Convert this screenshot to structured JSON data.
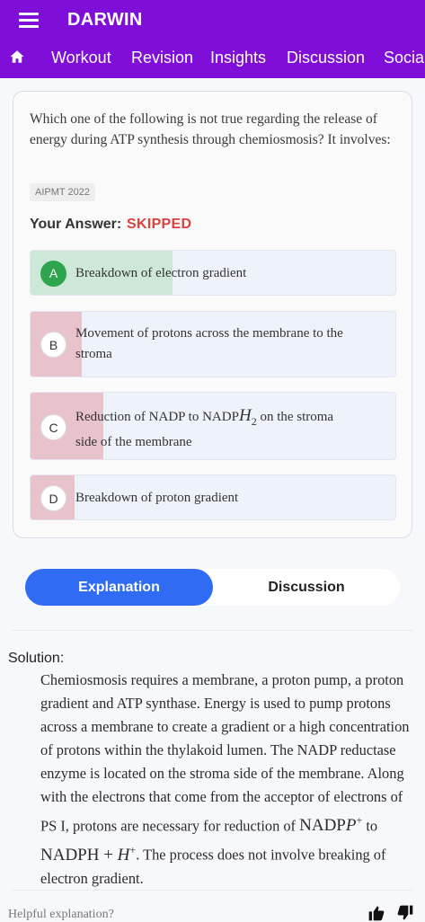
{
  "header": {
    "app_title": "DARWIN",
    "tabs": [
      "Workout",
      "Revision",
      "Insights",
      "Discussion",
      "Social"
    ]
  },
  "question": {
    "text": "Which one of the following is not true regarding the release of energy during ATP synthesis through chemiosmosis? It involves:",
    "exam_tag": "AIPMT 2022",
    "answer_label": "Your Answer:",
    "answer_value": "SKIPPED",
    "options": [
      {
        "letter": "A",
        "text": "Breakdown of electron gradient",
        "correct": true,
        "fill_fraction": 0.39
      },
      {
        "letter": "B",
        "text": "Movement of protons across the membrane to the stroma",
        "correct": false,
        "fill_fraction": 0.14
      },
      {
        "letter": "C",
        "text_before": "Reduction of NADP to NADP",
        "text_math": "H",
        "text_sub": "2",
        "text_after": " on the stroma side of the membrane",
        "correct": false,
        "fill_fraction": 0.2
      },
      {
        "letter": "D",
        "text": "Breakdown of proton gradient",
        "correct": false,
        "fill_fraction": 0.12
      }
    ]
  },
  "tabs_toggle": {
    "explanation": "Explanation",
    "discussion": "Discussion"
  },
  "solution": {
    "label": "Solution:",
    "text_main": "Chemiosmosis requires a membrane, a proton pump, a proton gradient and ATP synthase. Energy is used to pump protons across a membrane to create a gradient or a high concentration of protons within the thylakoid lumen. The NADP reductase enzyme is located on the stroma side of the membrane. Along with the electrons that come from the acceptor of electrons of PS I, protons are necessary for reduction of ",
    "math_1": "NADP",
    "math_1_var": "P",
    "math_1_sup": "+",
    "text_to": " to ",
    "math_2": "NADPH + ",
    "math_2_var": "H",
    "math_2_sup": "+",
    "text_end": ". The process does not involve breaking of electron gradient."
  },
  "feedback": {
    "label": "Helpful explanation?",
    "thumbs_up": "thumbs-up-icon",
    "thumbs_down": "thumbs-down-icon"
  },
  "colors": {
    "header": "#7f0fd8",
    "correct_fill": "#cde8d6",
    "correct_badge": "#2ea44f",
    "wrong_fill": "#e9c3cc",
    "accent": "#2f6cf3",
    "skipped": "#d9413f"
  }
}
